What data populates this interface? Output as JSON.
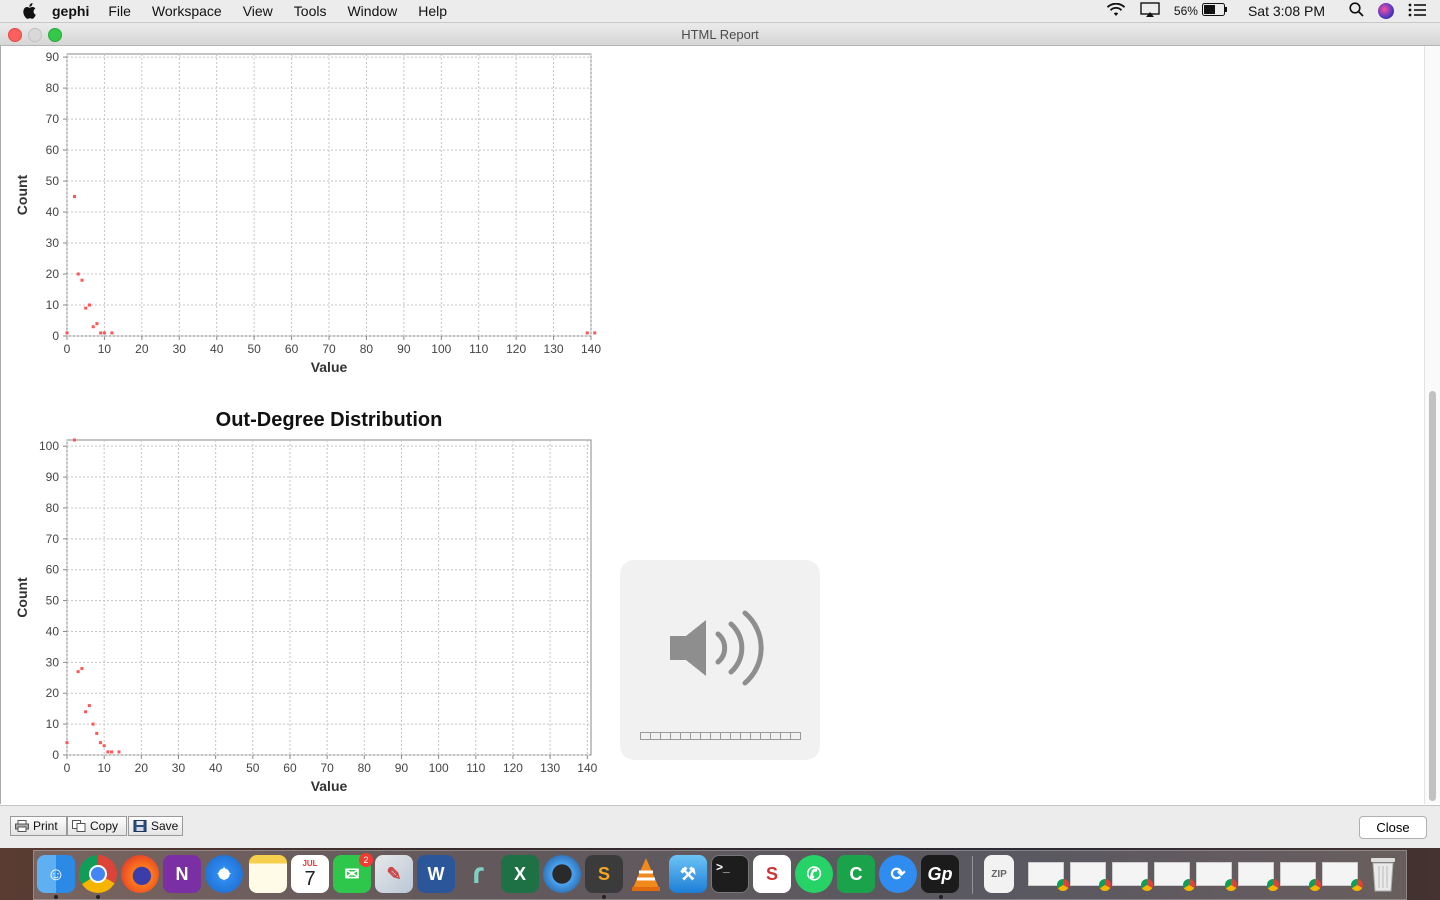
{
  "menubar": {
    "app_name": "gephi",
    "items": [
      "File",
      "Workspace",
      "View",
      "Tools",
      "Window",
      "Help"
    ],
    "battery_percent": "56%",
    "clock": "Sat 3:08 PM"
  },
  "window": {
    "title": "HTML Report",
    "colors": {
      "close": "#fc605c",
      "minimize": "#d8d8d8",
      "zoom": "#34c84a"
    }
  },
  "chart_data": [
    {
      "type": "scatter",
      "title": "",
      "xlabel": "Value",
      "ylabel": "Count",
      "xlim": [
        0,
        140
      ],
      "ylim": [
        0,
        91
      ],
      "xticks": [
        0,
        10,
        20,
        30,
        40,
        50,
        60,
        70,
        80,
        90,
        100,
        110,
        120,
        130,
        140
      ],
      "yticks": [
        0,
        10,
        20,
        30,
        40,
        50,
        60,
        70,
        80,
        90
      ],
      "grid": true,
      "color": "#ff5555",
      "points": [
        [
          0,
          1
        ],
        [
          2,
          45
        ],
        [
          3,
          20
        ],
        [
          4,
          18
        ],
        [
          5,
          9
        ],
        [
          6,
          10
        ],
        [
          7,
          3
        ],
        [
          8,
          4
        ],
        [
          9,
          1
        ],
        [
          10,
          1
        ],
        [
          12,
          1
        ],
        [
          139,
          1
        ],
        [
          141,
          1
        ]
      ]
    },
    {
      "type": "scatter",
      "title": "Out-Degree Distribution",
      "xlabel": "Value",
      "ylabel": "Count",
      "xlim": [
        0,
        141
      ],
      "ylim": [
        0,
        102
      ],
      "xticks": [
        0,
        10,
        20,
        30,
        40,
        50,
        60,
        70,
        80,
        90,
        100,
        110,
        120,
        130,
        140
      ],
      "yticks": [
        0,
        10,
        20,
        30,
        40,
        50,
        60,
        70,
        80,
        90,
        100
      ],
      "grid": true,
      "color": "#ff5555",
      "points": [
        [
          0,
          4
        ],
        [
          2,
          102
        ],
        [
          3,
          27
        ],
        [
          4,
          28
        ],
        [
          5,
          14
        ],
        [
          6,
          16
        ],
        [
          7,
          10
        ],
        [
          8,
          7
        ],
        [
          9,
          4
        ],
        [
          10,
          3
        ],
        [
          11,
          1
        ],
        [
          12,
          1
        ],
        [
          14,
          1
        ]
      ]
    }
  ],
  "volume_hud": {
    "icon": "speaker-volume-icon",
    "level": 0.0
  },
  "toolbar": {
    "print_label": "Print",
    "copy_label": "Copy",
    "save_label": "Save",
    "close_label": "Close"
  },
  "dock": {
    "apps": [
      "finder-icon",
      "chrome-icon",
      "firefox-icon",
      "onenote-icon",
      "safari-icon",
      "notes-icon",
      "calendar-icon",
      "messages-icon",
      "preview-icon",
      "word-icon",
      "app-r-icon",
      "excel-icon",
      "quicktime-icon",
      "sublime-icon",
      "vlc-icon",
      "xcode-icon",
      "terminal-icon",
      "scrivener-icon",
      "whatsapp-icon",
      "camtasia-icon",
      "share-icon",
      "gephi-icon"
    ],
    "calendar_month": "JUL",
    "calendar_day": "7",
    "messages_badge": "2"
  }
}
